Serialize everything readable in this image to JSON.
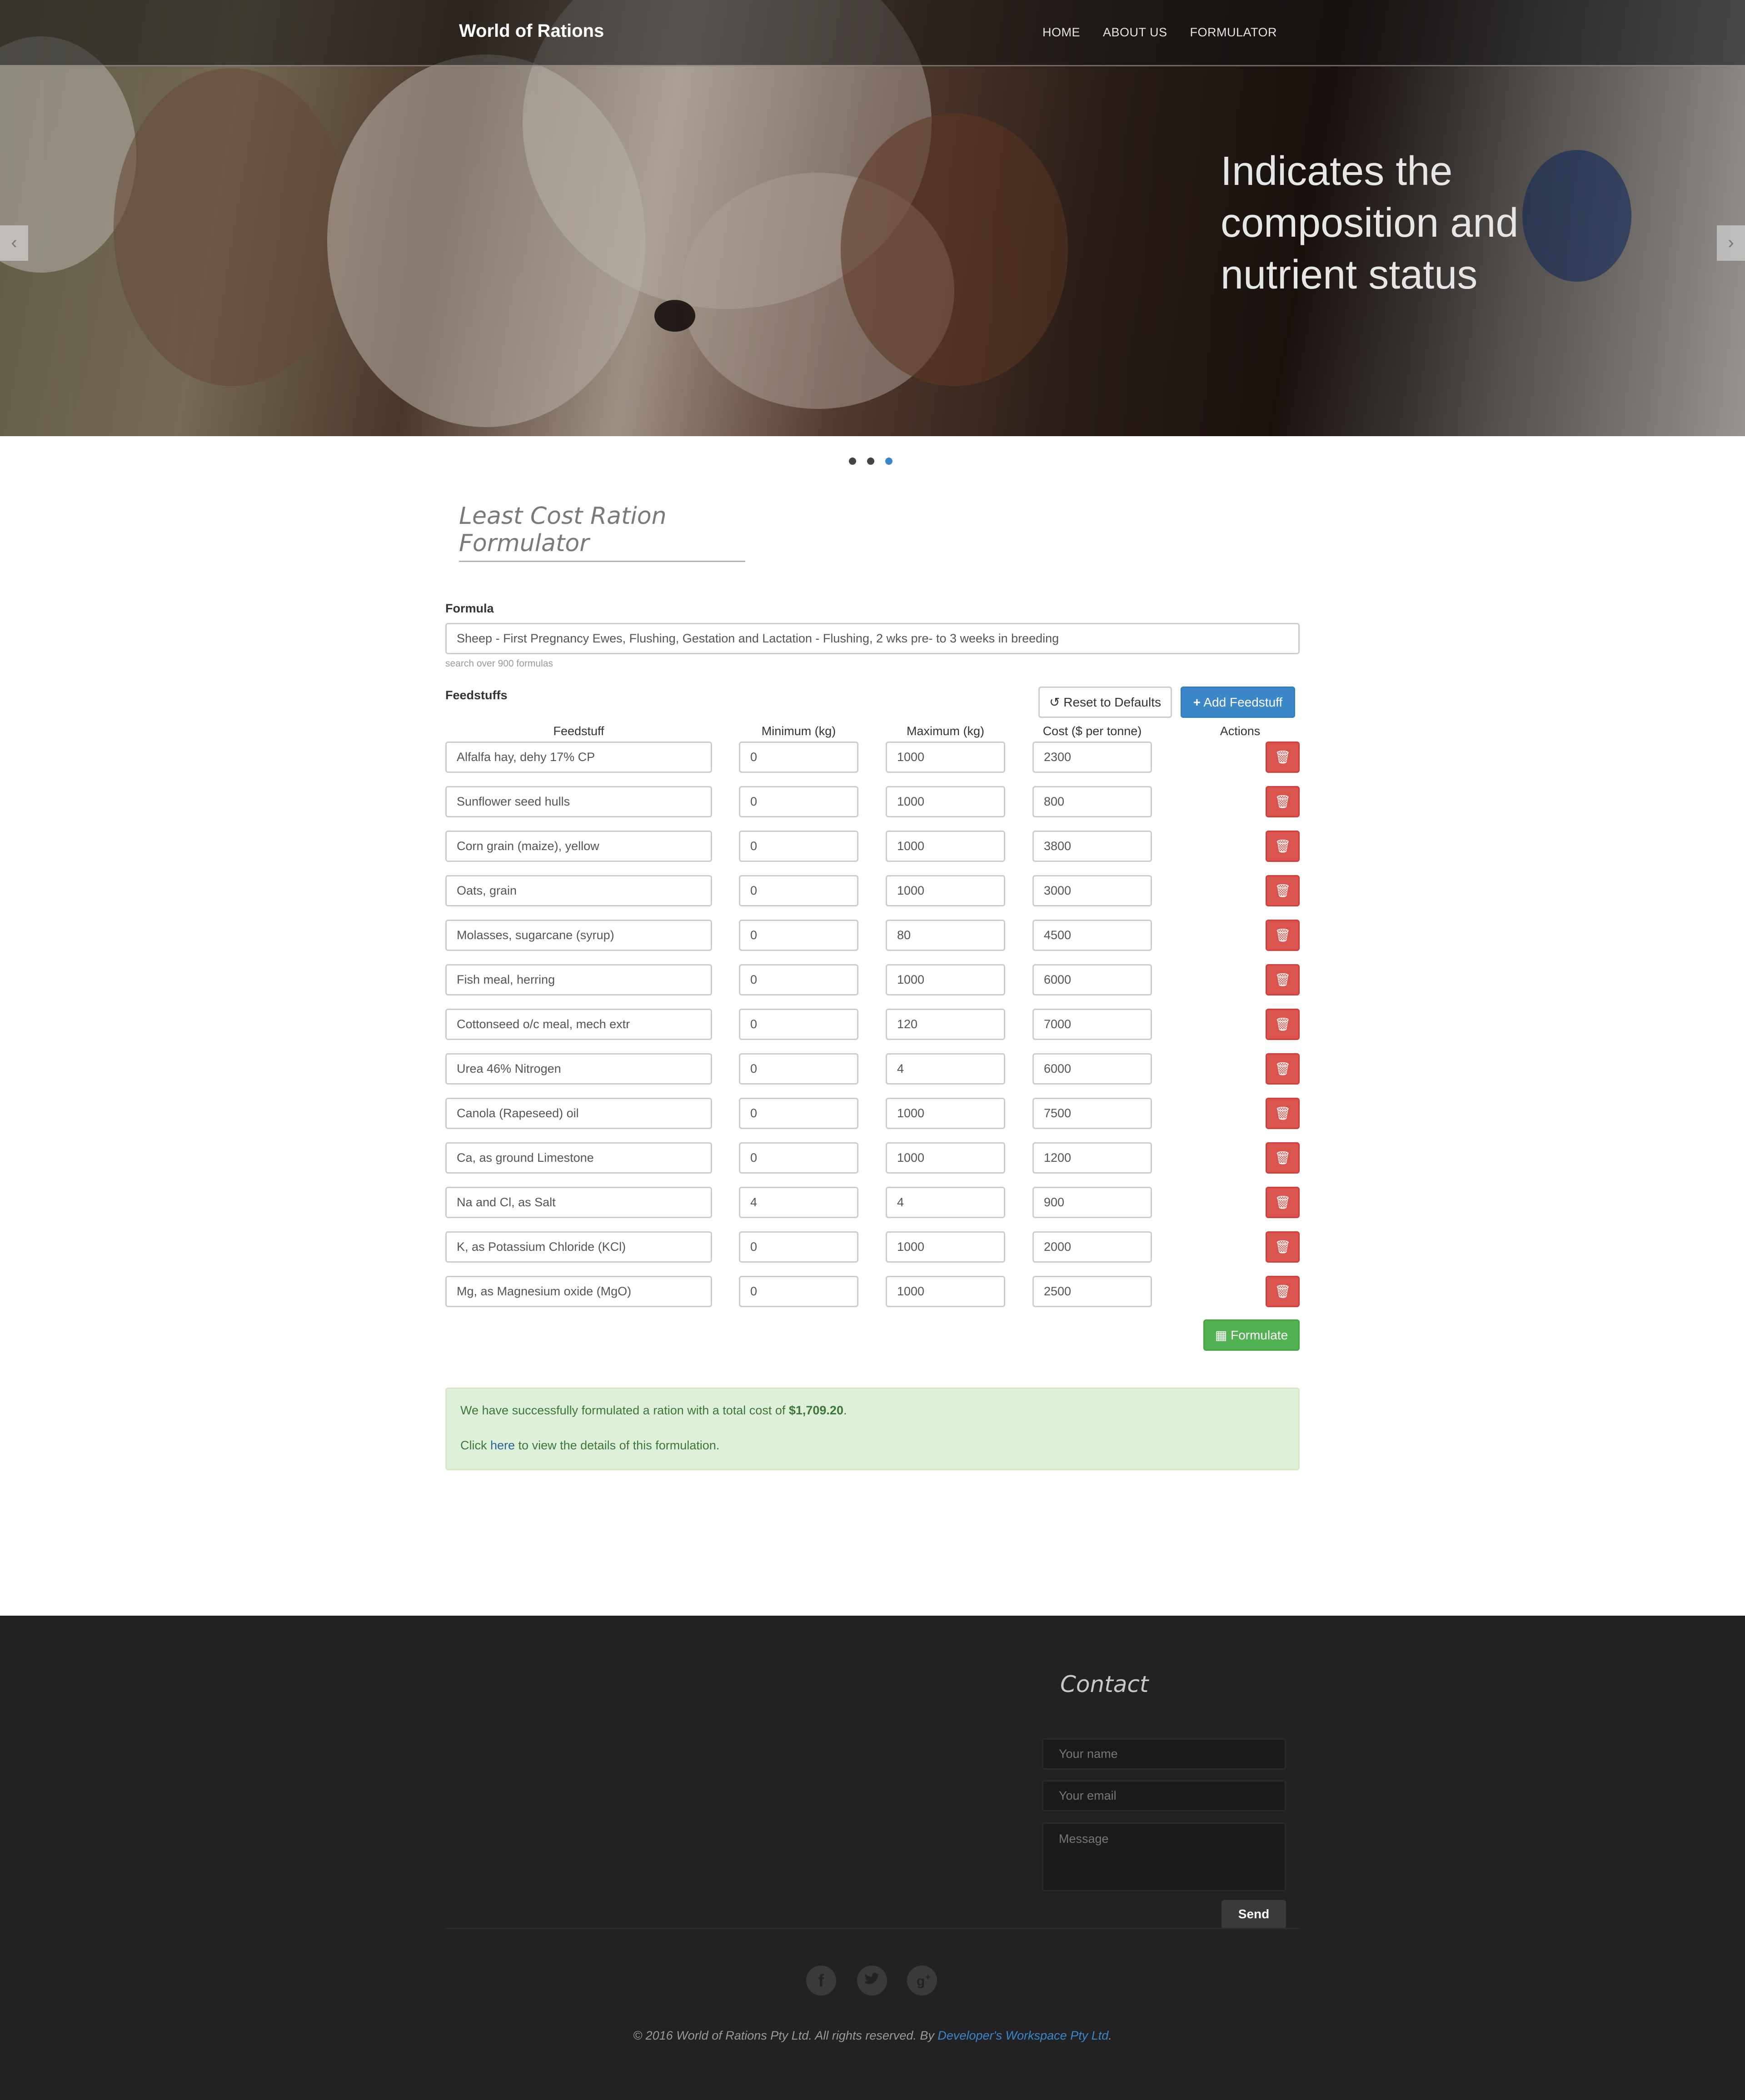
{
  "nav": {
    "brand": "World of Rations",
    "links": [
      "HOME",
      "ABOUT US",
      "FORMULATOR"
    ]
  },
  "hero": {
    "caption": "Indicates the composition and nutrient status",
    "prev_icon": "chevron-left-icon",
    "next_icon": "chevron-right-icon",
    "slide_count": 3,
    "active_slide": 3
  },
  "page": {
    "title": "Least Cost Ration Formulator"
  },
  "formula": {
    "label": "Formula",
    "value": "Sheep - First Pregnancy Ewes, Flushing, Gestation and Lactation - Flushing, 2 wks pre- to 3 weeks in breeding",
    "help": "search over 900 formulas"
  },
  "feedstuffs": {
    "label": "Feedstuffs",
    "reset_label": "Reset to Defaults",
    "add_label": "Add Feedstuff",
    "columns": [
      "Feedstuff",
      "Minimum (kg)",
      "Maximum (kg)",
      "Cost ($ per tonne)",
      "Actions"
    ],
    "rows": [
      {
        "name": "Alfalfa hay, dehy 17% CP",
        "min": "0",
        "max": "1000",
        "cost": "2300"
      },
      {
        "name": "Sunflower seed hulls",
        "min": "0",
        "max": "1000",
        "cost": "800"
      },
      {
        "name": "Corn grain (maize),  yellow",
        "min": "0",
        "max": "1000",
        "cost": "3800"
      },
      {
        "name": "Oats, grain",
        "min": "0",
        "max": "1000",
        "cost": "3000"
      },
      {
        "name": "Molasses, sugarcane (syrup)",
        "min": "0",
        "max": "80",
        "cost": "4500"
      },
      {
        "name": "Fish meal, herring",
        "min": "0",
        "max": "1000",
        "cost": "6000"
      },
      {
        "name": "Cottonseed o/c meal, mech extr",
        "min": "0",
        "max": "120",
        "cost": "7000"
      },
      {
        "name": "Urea 46% Nitrogen",
        "min": "0",
        "max": "4",
        "cost": "6000"
      },
      {
        "name": "Canola (Rapeseed) oil",
        "min": "0",
        "max": "1000",
        "cost": "7500"
      },
      {
        "name": "Ca, as ground Limestone",
        "min": "0",
        "max": "1000",
        "cost": "1200"
      },
      {
        "name": "Na and Cl, as Salt",
        "min": "4",
        "max": "4",
        "cost": "900"
      },
      {
        "name": "K, as Potassium Chloride (KCl)",
        "min": "0",
        "max": "1000",
        "cost": "2000"
      },
      {
        "name": "Mg, as Magnesium oxide (MgO)",
        "min": "0",
        "max": "1000",
        "cost": "2500"
      }
    ],
    "formulate_label": "Formulate"
  },
  "result": {
    "line1_prefix": "We have successfully formulated a ration with a total cost of ",
    "total_cost": "$1,709.20",
    "line1_suffix": ".",
    "line2_prefix": "Click ",
    "link": "here",
    "line2_suffix": " to view the details of this formulation."
  },
  "footer": {
    "contact_title": "Contact",
    "name_placeholder": "Your name",
    "email_placeholder": "Your email",
    "message_placeholder": "Message",
    "send_label": "Send",
    "social": [
      "facebook-icon",
      "twitter-icon",
      "google-plus-icon"
    ],
    "copyright_prefix": "© 2016 World of Rations Pty Ltd. All rights reserved. By ",
    "developer": "Developer's Workspace Pty Ltd",
    "copyright_suffix": "."
  },
  "colors": {
    "primary": "#3b87c8",
    "danger": "#d9534f",
    "success": "#52b152",
    "alert_bg": "#dff0d8",
    "footer_bg": "#222225"
  }
}
